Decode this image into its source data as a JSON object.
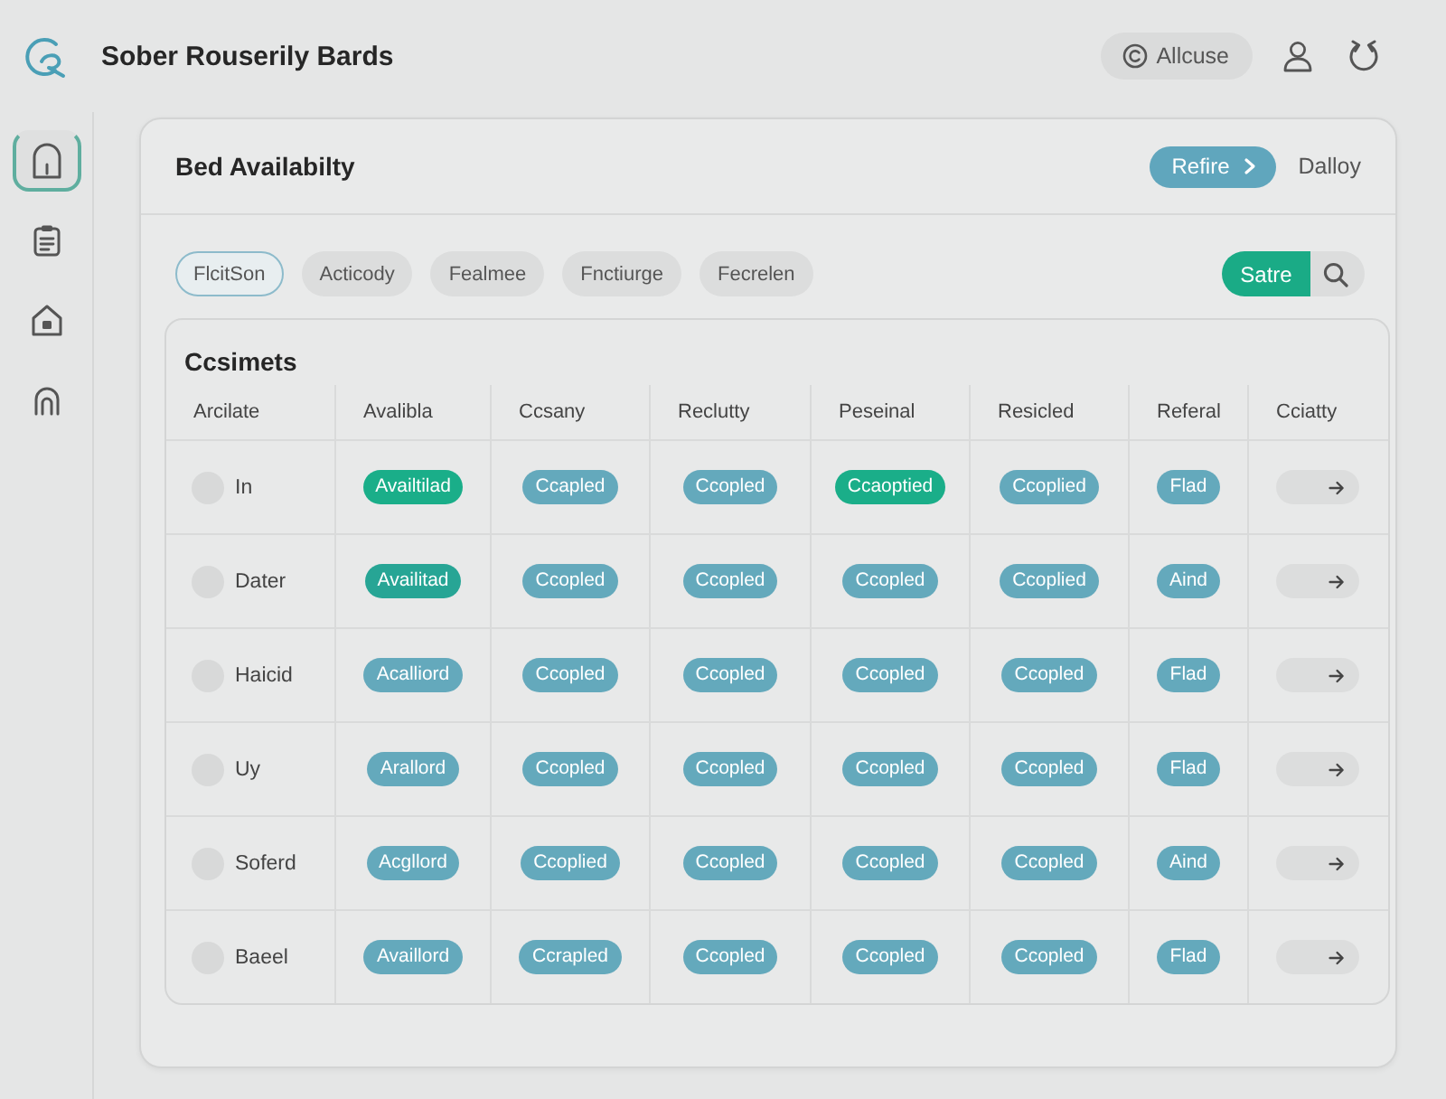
{
  "app": {
    "title": "Sober Rouserily Bards"
  },
  "header": {
    "account_label": "Allcuse"
  },
  "sidebar": {
    "items": [
      {
        "kind": "home",
        "selected": true
      },
      {
        "kind": "clipboard",
        "selected": false
      },
      {
        "kind": "house",
        "selected": false
      },
      {
        "kind": "headphones",
        "selected": false
      }
    ]
  },
  "panel": {
    "title": "Bed Availabilty",
    "refresh_button": "Refire",
    "link": "Dalloy"
  },
  "filters": [
    {
      "label": "FlcitSon",
      "selected": true
    },
    {
      "label": "Acticody",
      "selected": false
    },
    {
      "label": "Fealmee",
      "selected": false
    },
    {
      "label": "Fnctiurge",
      "selected": false
    },
    {
      "label": "Fecrelen",
      "selected": false
    }
  ],
  "save_button": "Satre",
  "table": {
    "title": "Ccsimets",
    "columns": [
      "Arcilate",
      "Avalibla",
      "Ccsany",
      "Reclutty",
      "Peseinal",
      "Resicled",
      "Referal",
      "Cciatty"
    ],
    "rows": [
      {
        "cells": [
          {
            "kind": "name",
            "label": "In"
          },
          {
            "kind": "badge",
            "label": "Availtilad",
            "color": "#1aae89"
          },
          {
            "kind": "badge",
            "label": "Ccapled",
            "color": "#64a9bc"
          },
          {
            "kind": "badge",
            "label": "Ccopled",
            "color": "#64a9bc"
          },
          {
            "kind": "badge",
            "label": "Ccaoptied",
            "color": "#1aae89"
          },
          {
            "kind": "badge",
            "label": "Ccoplied",
            "color": "#64a9bc"
          },
          {
            "kind": "badge",
            "label": "Flad",
            "color": "#64a9bc"
          },
          {
            "kind": "action"
          }
        ]
      },
      {
        "cells": [
          {
            "kind": "name",
            "label": "Dater"
          },
          {
            "kind": "badge",
            "label": "Availitad",
            "color": "#27a595"
          },
          {
            "kind": "badge",
            "label": "Ccopled",
            "color": "#64a9bc"
          },
          {
            "kind": "badge",
            "label": "Ccopled",
            "color": "#64a9bc"
          },
          {
            "kind": "badge",
            "label": "Ccopled",
            "color": "#64a9bc"
          },
          {
            "kind": "badge",
            "label": "Ccoplied",
            "color": "#64a9bc"
          },
          {
            "kind": "badge",
            "label": "Aind",
            "color": "#64a9bc"
          },
          {
            "kind": "action"
          }
        ]
      },
      {
        "cells": [
          {
            "kind": "name",
            "label": "Haicid"
          },
          {
            "kind": "badge",
            "label": "Acalliord",
            "color": "#64a9bc"
          },
          {
            "kind": "badge",
            "label": "Ccopled",
            "color": "#64a9bc"
          },
          {
            "kind": "badge",
            "label": "Ccopled",
            "color": "#64a9bc"
          },
          {
            "kind": "badge",
            "label": "Ccopled",
            "color": "#64a9bc"
          },
          {
            "kind": "badge",
            "label": "Ccopled",
            "color": "#64a9bc"
          },
          {
            "kind": "badge",
            "label": "Flad",
            "color": "#64a9bc"
          },
          {
            "kind": "action"
          }
        ]
      },
      {
        "cells": [
          {
            "kind": "name",
            "label": "Uy"
          },
          {
            "kind": "badge",
            "label": "Arallord",
            "color": "#64a9bc"
          },
          {
            "kind": "badge",
            "label": "Ccopled",
            "color": "#64a9bc"
          },
          {
            "kind": "badge",
            "label": "Ccopled",
            "color": "#64a9bc"
          },
          {
            "kind": "badge",
            "label": "Ccopled",
            "color": "#64a9bc"
          },
          {
            "kind": "badge",
            "label": "Ccopled",
            "color": "#64a9bc"
          },
          {
            "kind": "badge",
            "label": "Flad",
            "color": "#64a9bc"
          },
          {
            "kind": "action"
          }
        ]
      },
      {
        "cells": [
          {
            "kind": "name",
            "label": "Soferd"
          },
          {
            "kind": "badge",
            "label": "Acgllord",
            "color": "#64a9bc"
          },
          {
            "kind": "badge",
            "label": "Ccoplied",
            "color": "#64a9bc"
          },
          {
            "kind": "badge",
            "label": "Ccopled",
            "color": "#64a9bc"
          },
          {
            "kind": "badge",
            "label": "Ccopled",
            "color": "#64a9bc"
          },
          {
            "kind": "badge",
            "label": "Ccopled",
            "color": "#64a9bc"
          },
          {
            "kind": "badge",
            "label": "Aind",
            "color": "#64a9bc"
          },
          {
            "kind": "action"
          }
        ]
      },
      {
        "cells": [
          {
            "kind": "name",
            "label": "Baeel"
          },
          {
            "kind": "badge",
            "label": "Availlord",
            "color": "#64a9bc"
          },
          {
            "kind": "badge",
            "label": "Ccrapled",
            "color": "#64a9bc"
          },
          {
            "kind": "badge",
            "label": "Ccopled",
            "color": "#64a9bc"
          },
          {
            "kind": "badge",
            "label": "Ccopled",
            "color": "#64a9bc"
          },
          {
            "kind": "badge",
            "label": "Ccopled",
            "color": "#64a9bc"
          },
          {
            "kind": "badge",
            "label": "Flad",
            "color": "#64a9bc"
          },
          {
            "kind": "action"
          }
        ]
      }
    ]
  }
}
